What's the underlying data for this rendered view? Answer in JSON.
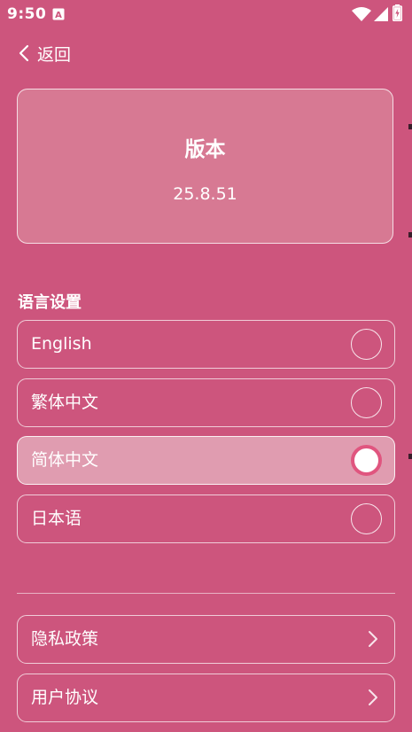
{
  "status_bar": {
    "time": "9:50",
    "notification_icon": "a-app-icon",
    "wifi_icon": "wifi-icon",
    "signal_icon": "signal-icon",
    "battery_icon": "battery-charging-icon"
  },
  "header": {
    "back_label": "返回",
    "back_icon": "chevron-left-icon"
  },
  "version_card": {
    "title": "版本",
    "version": "25.8.51"
  },
  "language_settings": {
    "title": "语言设置",
    "options": [
      {
        "label": "English",
        "selected": false
      },
      {
        "label": "繁体中文",
        "selected": false
      },
      {
        "label": "简体中文",
        "selected": true
      },
      {
        "label": "日本语",
        "selected": false
      }
    ]
  },
  "links": [
    {
      "label": "隐私政策",
      "icon": "chevron-right-icon"
    },
    {
      "label": "用户协议",
      "icon": "chevron-right-icon"
    }
  ],
  "colors": {
    "background": "#cd557d",
    "card": "#d77993",
    "selected_row": "#e09cb0",
    "radio_ring": "#e0557f",
    "text": "#ffffff"
  }
}
